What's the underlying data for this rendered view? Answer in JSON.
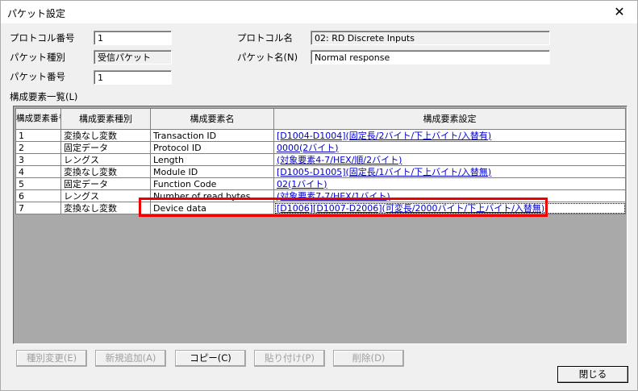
{
  "window": {
    "title": "パケット設定",
    "close_glyph": "✕"
  },
  "header": {
    "protocol_no_label": "プロトコル番号",
    "protocol_no_value": "1",
    "packet_type_label": "パケット種別",
    "packet_type_value": "受信パケット",
    "packet_no_label": "パケット番号",
    "packet_no_value": "1",
    "protocol_name_label": "プロトコル名",
    "protocol_name_value": "02: RD Discrete Inputs",
    "packet_name_label": "パケット名(N)",
    "packet_name_value": "Normal response"
  },
  "elements": {
    "section_label": "構成要素一覧(L)",
    "columns": [
      "構成要素番号",
      "構成要素種別",
      "構成要素名",
      "構成要素設定"
    ],
    "rows": [
      {
        "no": "1",
        "type": "変換なし変数",
        "name": "Transaction ID",
        "setting": "[D1004-D1004](固定長/2バイト/下上バイト/入替有)"
      },
      {
        "no": "2",
        "type": "固定データ",
        "name": "Protocol ID",
        "setting": "0000(2バイト)"
      },
      {
        "no": "3",
        "type": "レングス",
        "name": "Length",
        "setting": "(対象要素4-7/HEX/順/2バイト)"
      },
      {
        "no": "4",
        "type": "変換なし変数",
        "name": "Module ID",
        "setting": "[D1005-D1005](固定長/1バイト/下上バイト/入替無)"
      },
      {
        "no": "5",
        "type": "固定データ",
        "name": "Function Code",
        "setting": "02(1バイト)"
      },
      {
        "no": "6",
        "type": "レングス",
        "name": "Number of read bytes",
        "setting": "(対象要素7-7/HEX/1バイト)"
      },
      {
        "no": "7",
        "type": "変換なし変数",
        "name": "Device data",
        "setting": "[D1006][D1007-D2006](可変長/2000バイト/下上バイト/入替無)"
      }
    ]
  },
  "buttons": {
    "change_type": "種別変更(E)",
    "add_new": "新規追加(A)",
    "copy": "コピー(C)",
    "paste": "貼り付け(P)",
    "delete": "削除(D)",
    "close": "閉じる"
  },
  "colors": {
    "highlight": "#ee0000",
    "link": "#0000cc",
    "grid_background": "#a9a9a9"
  }
}
